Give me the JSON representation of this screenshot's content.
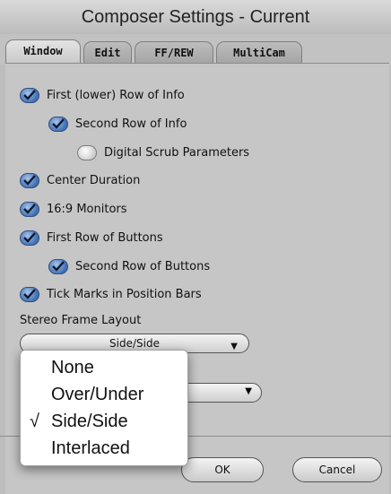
{
  "window": {
    "title": "Composer Settings - Current"
  },
  "tabs": [
    {
      "label": "Window"
    },
    {
      "label": "Edit"
    },
    {
      "label": "FF/REW"
    },
    {
      "label": "MultiCam"
    }
  ],
  "checkboxes": [
    {
      "label": "First (lower) Row of Info",
      "checked": true
    },
    {
      "label": "Second Row of Info",
      "checked": true
    },
    {
      "label": "Digital Scrub Parameters",
      "checked": false
    },
    {
      "label": "Center Duration",
      "checked": true
    },
    {
      "label": "16:9 Monitors",
      "checked": true
    },
    {
      "label": "First Row of Buttons",
      "checked": true
    },
    {
      "label": "Second Row of Buttons",
      "checked": true
    },
    {
      "label": "Tick Marks in Position Bars",
      "checked": true
    }
  ],
  "stereo": {
    "label": "Stereo Frame Layout",
    "selected": "Side/Side",
    "options": [
      "None",
      "Over/Under",
      "Side/Side",
      "Interlaced"
    ],
    "checkmark": "√"
  },
  "buttons": {
    "ok": "OK",
    "cancel": "Cancel"
  },
  "colors": {
    "checkbox_accent": "#3f6fb3"
  }
}
